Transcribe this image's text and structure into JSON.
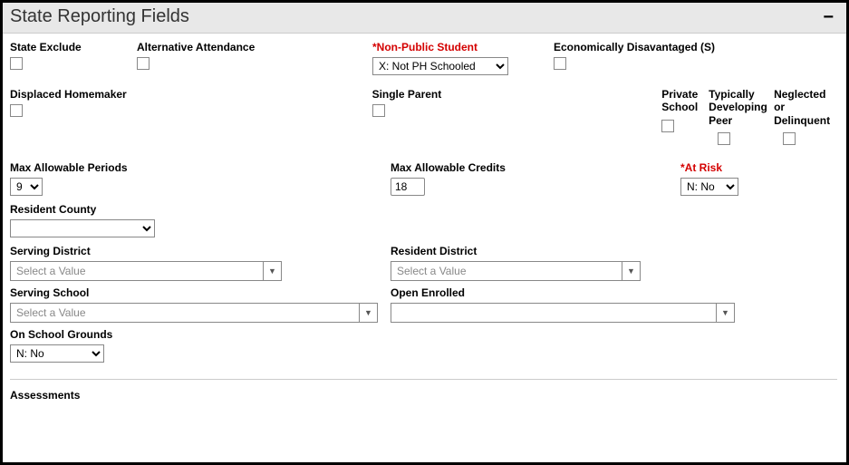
{
  "header": {
    "title": "State Reporting Fields",
    "collapse_glyph": "−"
  },
  "row1": {
    "state_exclude": {
      "label": "State Exclude"
    },
    "alt_attendance": {
      "label": "Alternative Attendance"
    },
    "non_public": {
      "label": "*Non-Public Student",
      "value": "X: Not PH Schooled"
    },
    "econ_disadv": {
      "label": "Economically Disavantaged (S)"
    }
  },
  "row2": {
    "displaced": {
      "label": "Displaced Homemaker"
    },
    "single_parent": {
      "label": "Single Parent"
    },
    "private_school": {
      "label": "Private School"
    },
    "typ_peer": {
      "label": "Typically Developing Peer"
    },
    "neglected": {
      "label": "Neglected or Delinquent"
    }
  },
  "row3": {
    "max_periods": {
      "label": "Max Allowable Periods",
      "value": "9"
    },
    "max_credits": {
      "label": "Max Allowable Credits",
      "value": "18"
    },
    "at_risk": {
      "label": "*At Risk",
      "value": "N: No"
    }
  },
  "row4": {
    "resident_county": {
      "label": "Resident County",
      "value": ""
    }
  },
  "row5": {
    "serving_district": {
      "label": "Serving District",
      "placeholder": "Select a Value"
    },
    "resident_district": {
      "label": "Resident District",
      "placeholder": "Select a Value"
    }
  },
  "row6": {
    "serving_school": {
      "label": "Serving School",
      "placeholder": "Select a Value"
    },
    "open_enrolled": {
      "label": "Open Enrolled",
      "placeholder": ""
    }
  },
  "row7": {
    "on_grounds": {
      "label": "On School Grounds",
      "value": "N: No"
    }
  },
  "section2": {
    "title": "Assessments"
  }
}
